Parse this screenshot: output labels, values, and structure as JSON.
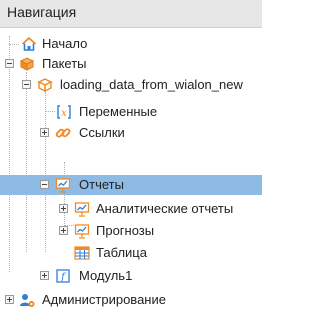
{
  "panel": {
    "title": "Навигация"
  },
  "tree": {
    "home": "Начало",
    "packages": "Пакеты",
    "package_name": "loading_data_from_wialon_new",
    "variables": "Переменные",
    "links": "Ссылки",
    "reports": "Отчеты",
    "analytic_reports": "Аналитические отчеты",
    "forecasts": "Прогнозы",
    "table": "Таблица",
    "module": "Модуль1",
    "administration": "Администрирование"
  },
  "icons": {
    "home": "home-icon",
    "packages": "packages-icon",
    "package": "package-icon",
    "variables": "variables-icon",
    "links": "links-icon",
    "reports": "reports-icon",
    "analytic_reports": "analytic-reports-icon",
    "forecasts": "forecasts-icon",
    "table": "table-icon",
    "module": "module-icon",
    "administration": "administration-icon"
  },
  "colors": {
    "selected_row": "#8dbbe6",
    "header_bg": "#e7e7e7",
    "orange_icon": "#f08a24",
    "blue_icon": "#2f7fd3"
  }
}
